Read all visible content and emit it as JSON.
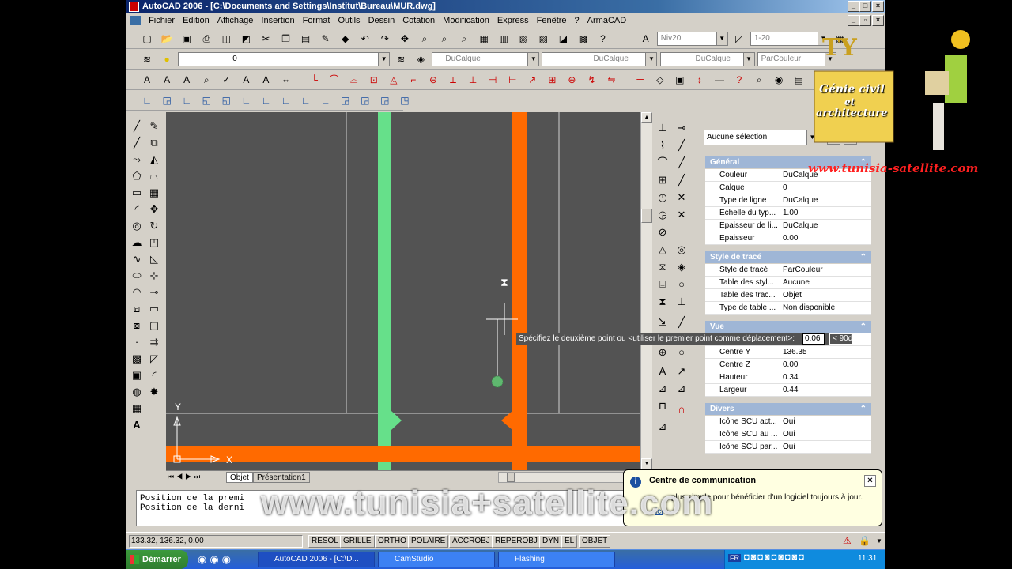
{
  "window": {
    "title": "AutoCAD 2006 - [C:\\Documents and Settings\\Institut\\Bureau\\MUR.dwg]"
  },
  "menu": [
    "Fichier",
    "Edition",
    "Affichage",
    "Insertion",
    "Format",
    "Outils",
    "Dessin",
    "Cotation",
    "Modification",
    "Express",
    "Fenêtre",
    "?",
    "ArmaCAD"
  ],
  "toolbar1": {
    "dimstyle": "Niv20",
    "scale": "1-20"
  },
  "toolbar2": {
    "layer": "0",
    "color": "DuCalque",
    "linetype": "DuCalque",
    "lineweight": "DuCalque",
    "plotstyle": "ParCouleur"
  },
  "drawing": {
    "tooltip_text": "Spécifiez le deuxième point ou <utiliser le premier point comme déplacement>:",
    "tooltip_value": "0.06",
    "tooltip_angle": "< 90d",
    "axis_y": "Y",
    "axis_x": "X"
  },
  "tabs": [
    "Objet",
    "Présentation1"
  ],
  "properties": {
    "selection": "Aucune sélection",
    "sections": [
      {
        "title": "Général",
        "rows": [
          {
            "label": "Couleur",
            "value": "DuCalque"
          },
          {
            "label": "Calque",
            "value": "0"
          },
          {
            "label": "Type de ligne",
            "value": "DuCalque"
          },
          {
            "label": "Echelle du typ...",
            "value": "1.00"
          },
          {
            "label": "Epaisseur de li...",
            "value": "DuCalque"
          },
          {
            "label": "Epaisseur",
            "value": "0.00"
          }
        ]
      },
      {
        "title": "Style de tracé",
        "rows": [
          {
            "label": "Style de tracé",
            "value": "ParCouleur"
          },
          {
            "label": "Table des styl...",
            "value": "Aucune"
          },
          {
            "label": "Table des trac...",
            "value": "Objet"
          },
          {
            "label": "Type de table ...",
            "value": "Non disponible"
          }
        ]
      },
      {
        "title": "Vue",
        "rows": [
          {
            "label": "Centre X",
            "value": ""
          },
          {
            "label": "Centre Y",
            "value": "136.35"
          },
          {
            "label": "Centre Z",
            "value": "0.00"
          },
          {
            "label": "Hauteur",
            "value": "0.34"
          },
          {
            "label": "Largeur",
            "value": "0.44"
          }
        ]
      },
      {
        "title": "Divers",
        "rows": [
          {
            "label": "Icône SCU act...",
            "value": "Oui"
          },
          {
            "label": "Icône SCU au ...",
            "value": "Oui"
          },
          {
            "label": "Icône SCU par...",
            "value": "Oui"
          }
        ]
      }
    ]
  },
  "command": {
    "line1": "Position de la premi",
    "line2": "Position de la derni"
  },
  "status": {
    "coords": "133.32, 136.32, 0.00",
    "buttons": [
      "RESOL",
      "GRILLE",
      "ORTHO",
      "POLAIRE",
      "ACCROBJ",
      "REPEROBJ",
      "DYN",
      "EL",
      "OBJET"
    ]
  },
  "notify": {
    "title": "Centre de communication",
    "text": "plus simple pour bénéficier d'un logiciel toujours à jour.",
    "link": "ici"
  },
  "taskbar": {
    "start": "Démarrer",
    "tasks": [
      "AutoCAD 2006 - [C:\\D...",
      "CamStudio",
      "Flashing"
    ],
    "time": "11:31",
    "lang": "FR"
  },
  "watermark": "www.tunisia+satellite.com",
  "logo": {
    "line1": "Génie civil",
    "line2": "et",
    "line3": "architecture",
    "url": "www.tunisia-satellite.com"
  },
  "colors": {
    "green_wall": "#66e08a",
    "orange_wall": "#ff6a00",
    "drawing_bg": "#535353"
  }
}
